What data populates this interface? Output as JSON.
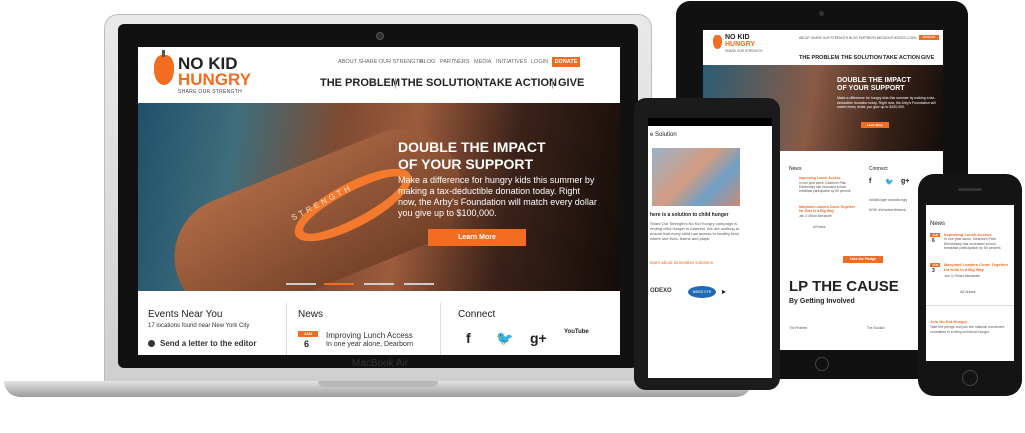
{
  "laptop": {
    "brand_label": "MacBook Air",
    "site": {
      "logo": {
        "line1": "NO KID",
        "line2": "HUNGRY",
        "tagline": "SHARE OUR STRENGTH"
      },
      "util_nav": [
        "ABOUT SHARE OUR STRENGTH",
        "BLOG",
        "PARTNERS",
        "MEDIA",
        "INITIATIVES",
        "LOGIN"
      ],
      "donate_label": "DONATE",
      "main_nav": [
        "THE PROBLEM",
        "THE SOLUTION",
        "TAKE ACTION",
        "GIVE"
      ],
      "hero": {
        "title_line1": "DOUBLE THE IMPACT",
        "title_line2": "OF YOUR SUPPORT",
        "body": "Make a difference for hungry kids this summer by making a tax-deductible donation today. Right now, the Arby's Foundation will match every dollar you give up to $100,000.",
        "button_label": "Learn More",
        "wristband_text": "STRENGTH"
      },
      "events": {
        "heading": "Events Near You",
        "count_text": "17 locations found near New York City",
        "link_text": "Send a letter to the editor"
      },
      "news": {
        "heading": "News",
        "month": "JAN",
        "day": "6",
        "headline": "Improving Lunch Access",
        "snippet": "In one year alone, Dearborn"
      },
      "connect": {
        "heading": "Connect",
        "icons": [
          "f",
          "twitter",
          "g+",
          "YouTube"
        ]
      }
    }
  },
  "tablet_large": {
    "logo": {
      "line1": "NO KID",
      "line2": "HUNGRY",
      "tagline": "SHARE OUR STRENGTH"
    },
    "util_nav": "ABOUT SHARE OUR STRENGTH   BLOG   PARTNERS   MEDIA   INITIATIVES   LOGIN",
    "donate_label": "DONATE",
    "main_nav": [
      "THE PROBLEM",
      "THE SOLUTION",
      "TAKE ACTION",
      "GIVE"
    ],
    "hero": {
      "title_line1": "DOUBLE THE IMPACT",
      "title_line2": "OF YOUR SUPPORT",
      "body": "Make a difference for hungry kids this summer by making a tax-deductible donation today. Right now, the Arby's Foundation will match every dollar you give up to $100,000.",
      "button_label": "Learn More"
    },
    "news": {
      "heading": "News",
      "item1": "Improving Lunch Access",
      "item1_text": "In one year alone, Dearborn Park Elementary has increased school breakfast participation by 50 percent.",
      "item2": "Maryland Leaders Come Together for Kids in a Big Way",
      "item2_text": "Jan 3 | Brian Alexander",
      "all_news": "All News"
    },
    "connect": {
      "heading": "Connect",
      "tweet": "NOW: #VolunteerNetwork...",
      "link": "#childhunger #nokidhungry"
    },
    "pledge_label": "Take the Pledge",
    "cta": {
      "line1": "LP THE CAUSE",
      "line2": "By Getting Involved"
    },
    "footer_labels": [
      "The Problem",
      "The Solution"
    ]
  },
  "tablet_small": {
    "section_title": "e Solution",
    "caption": "here is a solution to child hunger",
    "body": "Share Our Strength's No Kid Hungry campaign is ending child hunger in America. We are working to ensure that every child has access to healthy food where she lives, learns and plays.",
    "link_text": "learn about innovative solutions",
    "partner_label": "ODEXO",
    "partner2_label": "BIRDS EYE"
  },
  "phone": {
    "news_heading": "News",
    "month": "JAN",
    "day": "6",
    "item1": "Improving Lunch Access",
    "item1_text": "In one year alone, Dearborn Park Elementary has increased school breakfast participation by 50 percent.",
    "month2": "JAN",
    "day2": "3",
    "item2": "Maryland Leaders Come Together for Kids in a Big Way",
    "item2_text": "Jan 3 | Brian Alexander",
    "all_news": "All News",
    "join_title": "Join No Kid Hungry",
    "join_text": "Take the pledge and join the national movement committed to ending childhood hunger"
  },
  "colors": {
    "accent": "#f26c22",
    "device_dark": "#111111",
    "laptop_silver": "#d6d6d6"
  }
}
